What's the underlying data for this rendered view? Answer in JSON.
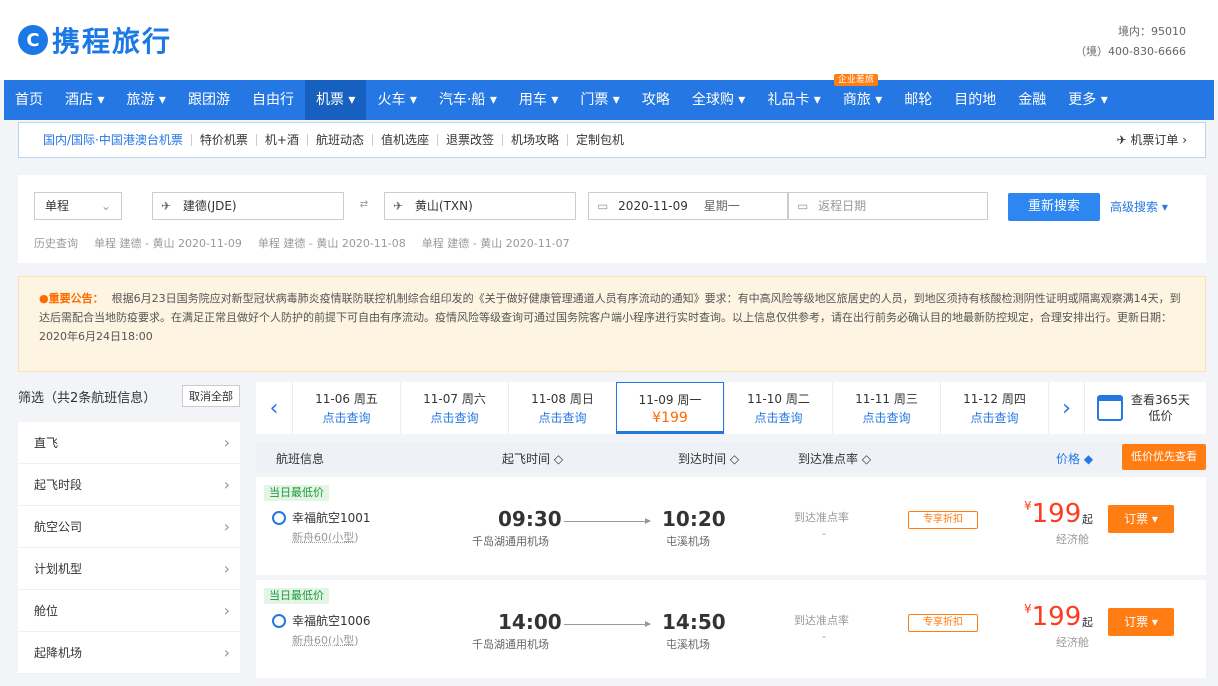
{
  "header": {
    "logo_mark": "C",
    "logo_text": "携程旅行",
    "hotline_1": "境内：95010",
    "hotline_2": "（境）400-830-6666"
  },
  "nav": {
    "items": [
      {
        "label": "首页",
        "active": false
      },
      {
        "label": "酒店 ▾",
        "active": false
      },
      {
        "label": "旅游 ▾",
        "active": false
      },
      {
        "label": "跟团游",
        "active": false
      },
      {
        "label": "自由行",
        "active": false
      },
      {
        "label": "机票 ▾",
        "active": true
      },
      {
        "label": "火车 ▾",
        "active": false
      },
      {
        "label": "汽车·船 ▾",
        "active": false
      },
      {
        "label": "用车 ▾",
        "active": false
      },
      {
        "label": "门票 ▾",
        "active": false
      },
      {
        "label": "攻略",
        "active": false
      },
      {
        "label": "全球购 ▾",
        "active": false
      },
      {
        "label": "礼品卡 ▾",
        "active": false
      },
      {
        "label": "商旅 ▾",
        "active": false,
        "badge": "企业差旅"
      },
      {
        "label": "邮轮",
        "active": false
      },
      {
        "label": "目的地",
        "active": false
      },
      {
        "label": "金融",
        "active": false
      },
      {
        "label": "更多 ▾",
        "active": false
      }
    ]
  },
  "subnav": {
    "items": [
      "国内/国际·中国港澳台机票",
      "特价机票",
      "机+酒",
      "航班动态",
      "值机选座",
      "退票改签",
      "机场攻略",
      "定制包机"
    ],
    "orders": "✈ 机票订单 ›"
  },
  "search": {
    "trip_type": "单程",
    "from": "建德(JDE)",
    "to": "黄山(TXN)",
    "depart_date": "2020-11-09",
    "depart_weekday": "星期一",
    "return_placeholder": "返程日期",
    "search_button": "重新搜索",
    "advanced": "高级搜索 ▾",
    "history_label": "历史查询",
    "history": [
      "单程 建德 - 黄山 2020-11-09",
      "单程 建德 - 黄山 2020-11-08",
      "单程 建德 - 黄山 2020-11-07"
    ]
  },
  "notice": {
    "title": "●重要公告：",
    "text": "根据6月23日国务院应对新型冠状病毒肺炎疫情联防联控机制综合组印发的《关于做好健康管理通道人员有序流动的通知》要求：有中高风险等级地区旅居史的人员，到地区须持有核酸检测阴性证明或隔离观察满14天，到达后需配合当地防疫要求。在满足正常且做好个人防护的前提下可自由有序流动。疫情风险等级查询可通过国务院客户端小程序进行实时查询。以上信息仅供参考，请在出行前务必确认目的地最新防控规定，合理安排出行。更新日期：2020年6月24日18:00"
  },
  "filter": {
    "title": "筛选（共2条航班信息）",
    "clear": "取消全部",
    "rows": [
      "直飞",
      "起飞时段",
      "航空公司",
      "计划机型",
      "舱位",
      "起降机场"
    ]
  },
  "dates": {
    "prev": "‹",
    "next": "›",
    "cells": [
      {
        "date": "11-06 周五",
        "sub": "点击查询",
        "active": false
      },
      {
        "date": "11-07 周六",
        "sub": "点击查询",
        "active": false
      },
      {
        "date": "11-08 周日",
        "sub": "点击查询",
        "active": false
      },
      {
        "date": "11-09 周一",
        "sub": "¥199",
        "active": true
      },
      {
        "date": "11-10 周二",
        "sub": "点击查询",
        "active": false
      },
      {
        "date": "11-11 周三",
        "sub": "点击查询",
        "active": false
      },
      {
        "date": "11-12 周四",
        "sub": "点击查询",
        "active": false
      }
    ],
    "calendar_1": "查看365天",
    "calendar_2": "低价"
  },
  "list_header": {
    "flight_info": "航班信息",
    "dep_time": "起飞时间 ◇",
    "arr_time": "到达时间 ◇",
    "ontime": "到达准点率 ◇",
    "price": "价格 ◆",
    "lowest_btn": "低价优先查看"
  },
  "flights": [
    {
      "tag": "当日最低价",
      "airline": "幸福航空1001",
      "plane": "新舟60(小型)",
      "dep_time": "09:30",
      "dep_airport": "千岛湖通用机场",
      "arr_time": "10:20",
      "arr_airport": "屯溪机场",
      "ontime": "到达准点率",
      "ontime_value": "-",
      "meal": "专享折扣",
      "price": "199",
      "price_currency": "¥",
      "price_suffix": "起",
      "cabin": "经济舱",
      "book": "订票 ▾"
    },
    {
      "tag": "当日最低价",
      "airline": "幸福航空1006",
      "plane": "新舟60(小型)",
      "dep_time": "14:00",
      "dep_airport": "千岛湖通用机场",
      "arr_time": "14:50",
      "arr_airport": "屯溪机场",
      "ontime": "到达准点率",
      "ontime_value": "-",
      "meal": "专享折扣",
      "price": "199",
      "price_currency": "¥",
      "price_suffix": "起",
      "cabin": "经济舱",
      "book": "订票 ▾"
    }
  ]
}
